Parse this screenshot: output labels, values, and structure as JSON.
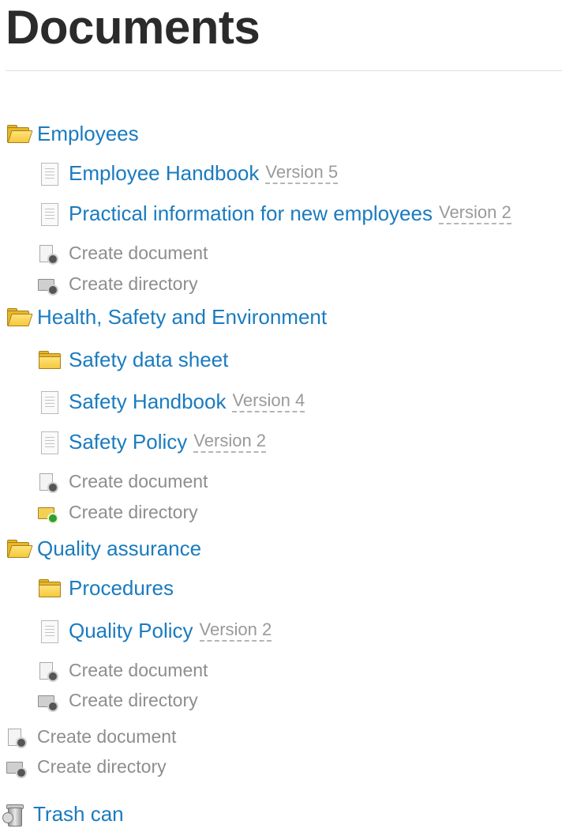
{
  "page_title": "Documents",
  "colors": {
    "link": "#1a7bbf",
    "muted": "#8e8e8e",
    "title": "#2b2b2b",
    "folder": "#e8b728"
  },
  "tree": {
    "employees": {
      "label": "Employees",
      "handbook": {
        "label": "Employee Handbook",
        "version": "Version 5"
      },
      "practical": {
        "label": "Practical information for new employees",
        "version": "Version 2"
      },
      "create_document": "Create document",
      "create_directory": "Create directory"
    },
    "hse": {
      "label": "Health, Safety and Environment",
      "safety_data_sheet": {
        "label": "Safety data sheet"
      },
      "safety_handbook": {
        "label": "Safety Handbook",
        "version": "Version 4"
      },
      "safety_policy": {
        "label": "Safety Policy",
        "version": "Version 2"
      },
      "create_document": "Create document",
      "create_directory": "Create directory"
    },
    "qa": {
      "label": "Quality assurance",
      "procedures": {
        "label": "Procedures"
      },
      "quality_policy": {
        "label": "Quality Policy",
        "version": "Version 2"
      },
      "create_document": "Create document",
      "create_directory": "Create directory"
    },
    "root_create_document": "Create document",
    "root_create_directory": "Create directory",
    "trash": "Trash can"
  },
  "icons": [
    "folder-open-icon",
    "folder-icon",
    "document-icon",
    "create-document-icon",
    "create-directory-icon",
    "trash-can-icon"
  ]
}
